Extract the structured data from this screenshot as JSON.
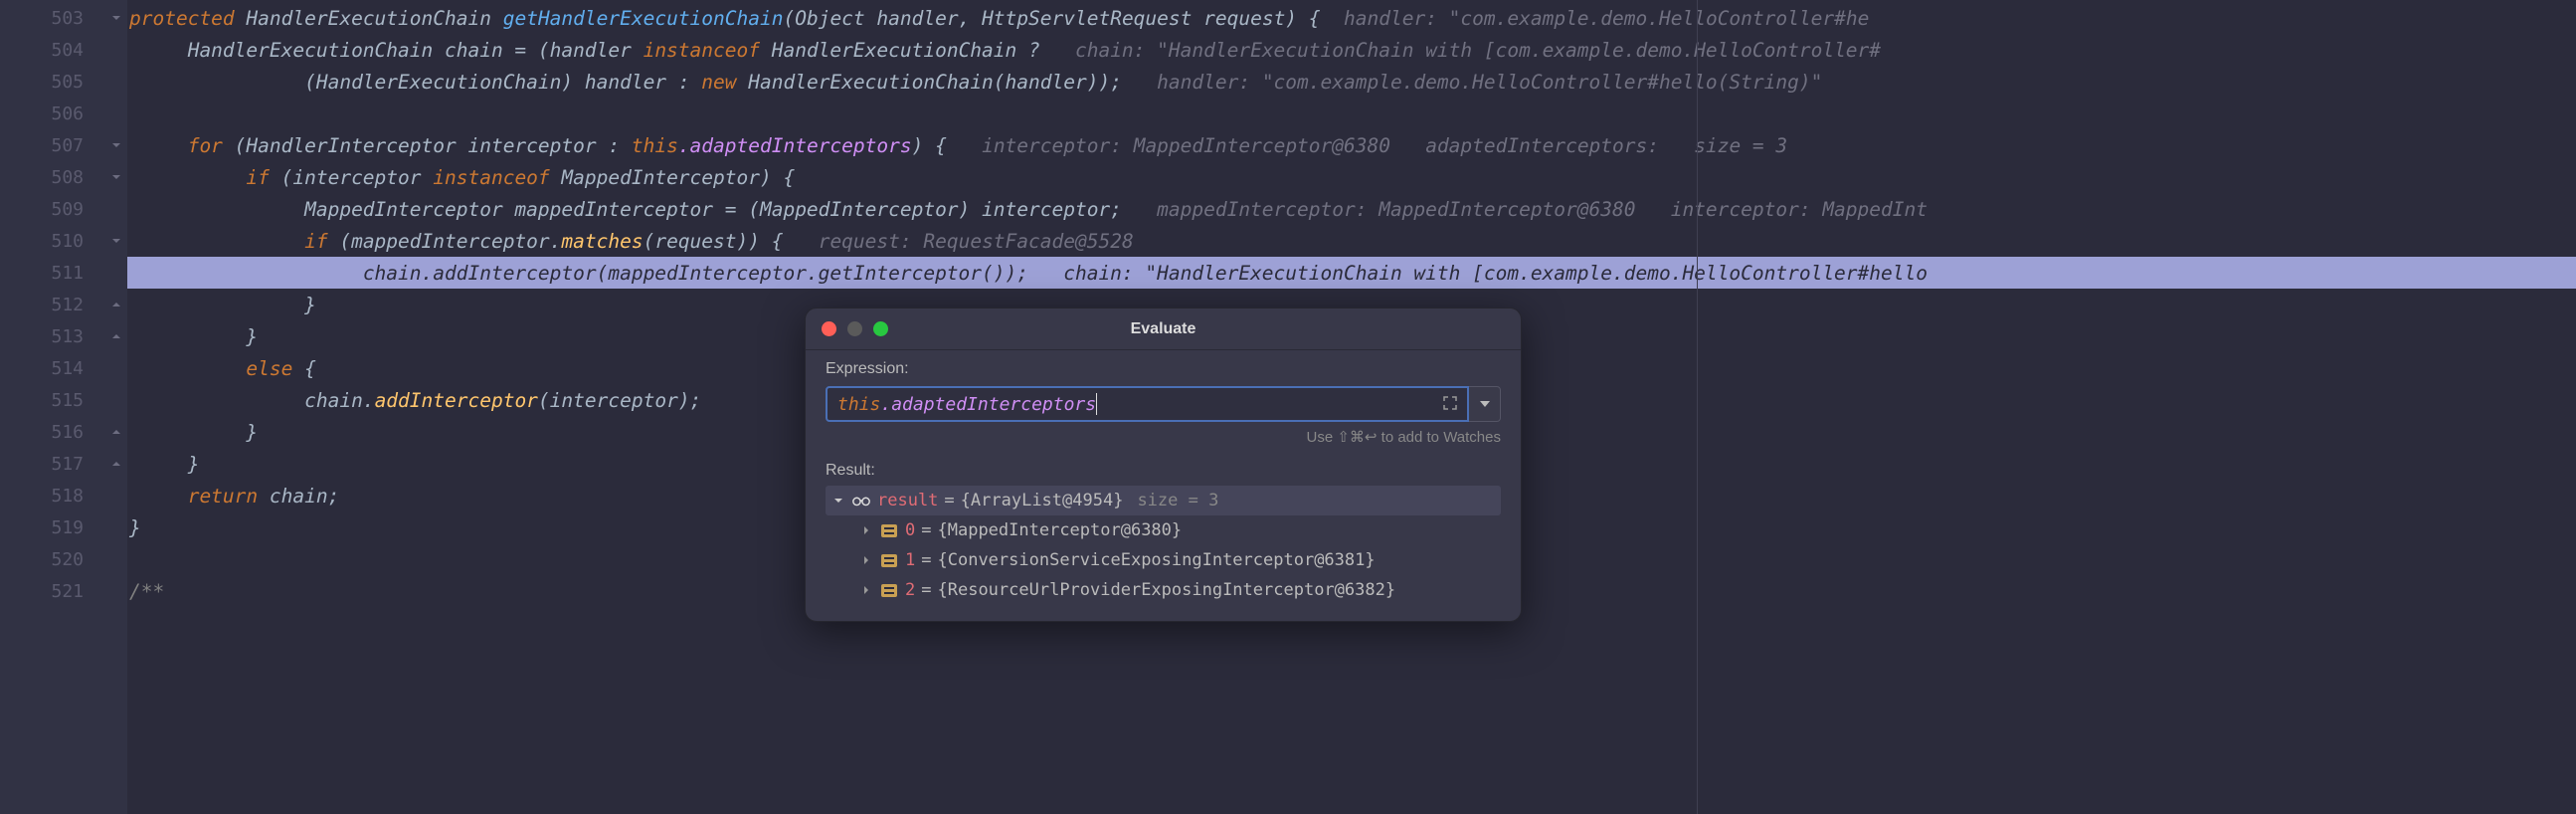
{
  "gutter": {
    "lines": [
      "503",
      "504",
      "505",
      "506",
      "507",
      "508",
      "509",
      "510",
      "511",
      "512",
      "513",
      "514",
      "515",
      "516",
      "517",
      "518",
      "519",
      "520",
      "521"
    ]
  },
  "code": {
    "l503": {
      "kw1": "protected",
      "type": "HandlerExecutionChain",
      "method": "getHandlerExecutionChain",
      "sig": "(Object handler, HttpServletRequest request) {",
      "hint": "  handler: \"com.example.demo.HelloController#he"
    },
    "l504": {
      "text1": "HandlerExecutionChain chain = (handler ",
      "kw": "instanceof",
      "text2": " HandlerExecutionChain ?",
      "hint": "   chain: \"HandlerExecutionChain with [com.example.demo.HelloController#"
    },
    "l505": {
      "text1": "(HandlerExecutionChain) handler : ",
      "kw": "new",
      "text2": " HandlerExecutionChain(handler));",
      "hint": "   handler: \"com.example.demo.HelloController#hello(String)\""
    },
    "l507": {
      "kw": "for",
      "text1": " (HandlerInterceptor interceptor : ",
      "this": "this",
      "field": ".adaptedInterceptors",
      "text2": ") {",
      "hint": "   interceptor: MappedInterceptor@6380   adaptedInterceptors:   size = 3"
    },
    "l508": {
      "kw1": "if",
      "text1": " (interceptor ",
      "kw2": "instanceof",
      "text2": " MappedInterceptor) {"
    },
    "l509": {
      "text": "MappedInterceptor mappedInterceptor = (MappedInterceptor) interceptor;",
      "hint": "   mappedInterceptor: MappedInterceptor@6380   interceptor: MappedInt"
    },
    "l510": {
      "kw": "if",
      "text1": " (mappedInterceptor.",
      "method": "matches",
      "text2": "(request)) {",
      "hint": "   request: RequestFacade@5528"
    },
    "l511": {
      "text": "chain.addInterceptor(mappedInterceptor.getInterceptor());",
      "hint": "   chain: \"HandlerExecutionChain with [com.example.demo.HelloController#hello"
    },
    "l512": {
      "text": "}"
    },
    "l513": {
      "text": "}"
    },
    "l514": {
      "kw": "else",
      "text": " {"
    },
    "l515": {
      "text1": "chain.",
      "method": "addInterceptor",
      "text2": "(interceptor);"
    },
    "l516": {
      "text": "}"
    },
    "l517": {
      "text": "}"
    },
    "l518": {
      "kw": "return",
      "text": " chain;"
    },
    "l519": {
      "text": "}"
    },
    "l521": {
      "text": "/**"
    }
  },
  "popup": {
    "title": "Evaluate",
    "expression_label": "Expression:",
    "expr_this": "this",
    "expr_field": ".adaptedInterceptors",
    "shortcut_hint": "Use ⇧⌘↩ to add to Watches",
    "result_label": "Result:",
    "result": {
      "name": "result",
      "value": "{ArrayList@4954}",
      "meta": "size = 3",
      "items": [
        {
          "idx": "0",
          "value": "{MappedInterceptor@6380}"
        },
        {
          "idx": "1",
          "value": "{ConversionServiceExposingInterceptor@6381}"
        },
        {
          "idx": "2",
          "value": "{ResourceUrlProviderExposingInterceptor@6382}"
        }
      ]
    }
  }
}
